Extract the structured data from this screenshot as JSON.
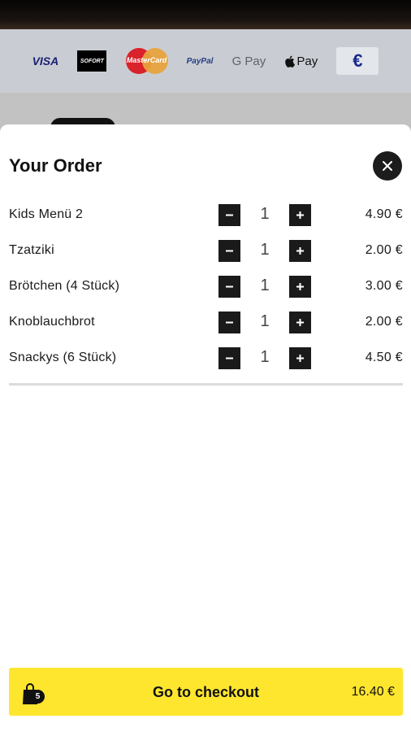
{
  "payment_methods": [
    {
      "name": "VISA",
      "icon": "visa-logo"
    },
    {
      "name": "SOFORT",
      "icon": "sofort-logo"
    },
    {
      "name": "MasterCard",
      "icon": "mastercard-logo"
    },
    {
      "name": "PayPal",
      "icon": "paypal-logo"
    },
    {
      "name": "G Pay",
      "icon": "google-pay-logo"
    },
    {
      "name": "Pay",
      "icon": "apple-pay-logo"
    },
    {
      "name": "€",
      "icon": "euro-icon"
    }
  ],
  "order": {
    "title": "Your Order",
    "items": [
      {
        "name": "Kids Menü 2",
        "qty": "1",
        "price": "4.90 €"
      },
      {
        "name": "Tzatziki",
        "qty": "1",
        "price": "2.00 €"
      },
      {
        "name": "Brötchen (4 Stück)",
        "qty": "1",
        "price": "3.00 €"
      },
      {
        "name": "Knoblauchbrot",
        "qty": "1",
        "price": "2.00 €"
      },
      {
        "name": "Snackys (6 Stück)",
        "qty": "1",
        "price": "4.50 €"
      }
    ]
  },
  "checkout": {
    "label": "Go to checkout",
    "item_count": "5",
    "total": "16.40 €"
  },
  "colors": {
    "accent": "#ffe62e",
    "dark": "#1a1a1a"
  }
}
